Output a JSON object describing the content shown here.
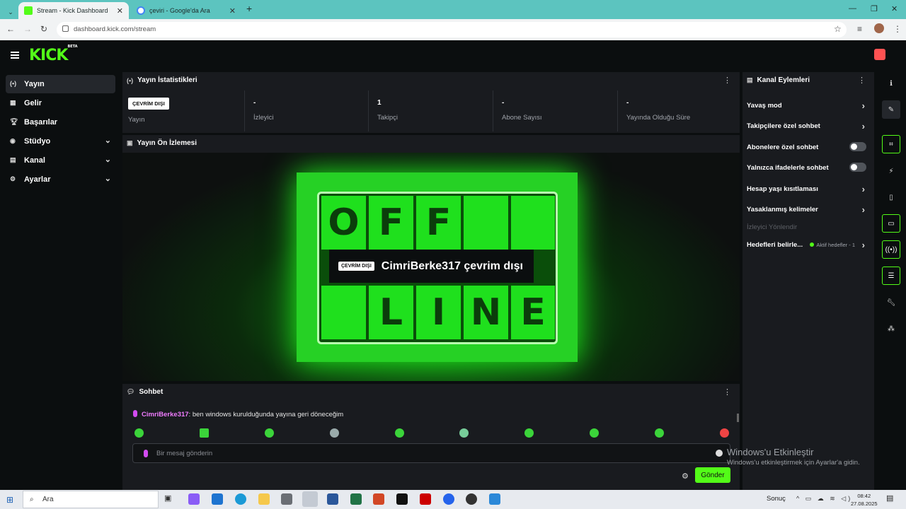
{
  "browser": {
    "tabs": [
      {
        "title": "Stream - Kick Dashboard",
        "favicon_color": "#53fc18"
      },
      {
        "title": "çeviri - Google'da Ara",
        "favicon_color": "#4285f4"
      }
    ],
    "url": "dashboard.kick.com/stream"
  },
  "header": {
    "logo": "KICK",
    "logo_badge": "BETA"
  },
  "sidebar": {
    "items": [
      {
        "label": "Yayın",
        "icon": "broadcast-icon",
        "active": true
      },
      {
        "label": "Gelir",
        "icon": "chart-icon"
      },
      {
        "label": "Başarılar",
        "icon": "trophy-icon"
      },
      {
        "label": "Stüdyo",
        "icon": "studio-icon",
        "expandable": true
      },
      {
        "label": "Kanal",
        "icon": "channel-icon",
        "expandable": true
      },
      {
        "label": "Ayarlar",
        "icon": "gear-icon",
        "expandable": true
      }
    ]
  },
  "stats": {
    "title": "Yayın İstatistikleri",
    "badge": "ÇEVRİM DIŞI",
    "cells": [
      {
        "value": "",
        "label": "Yayın"
      },
      {
        "value": "-",
        "label": "İzleyici"
      },
      {
        "value": "1",
        "label": "Takipçi"
      },
      {
        "value": "-",
        "label": "Abone Sayısı"
      },
      {
        "value": "-",
        "label": "Yayında Olduğu Süre"
      }
    ]
  },
  "preview": {
    "title": "Yayın Ön İzlemesi",
    "sign_letters": [
      "O",
      "F",
      "F",
      "",
      "",
      "",
      "L",
      "I",
      "N",
      "E"
    ],
    "overlay_badge": "ÇEVRİM DIŞI",
    "overlay_text": "CimriBerke317 çevrim dışı"
  },
  "chat": {
    "title": "Sohbet",
    "message_user": "CimriBerke317",
    "message_text": ": ben windows kurulduğunda yayına geri döneceğim",
    "placeholder": "Bir mesaj gönderin",
    "send_label": "Gönder",
    "emote_count": 10
  },
  "actions": {
    "title": "Kanal Eylemleri",
    "items": [
      {
        "label": "Yavaş mod",
        "control": "arrow"
      },
      {
        "label": "Takipçilere özel sohbet",
        "control": "arrow"
      },
      {
        "label": "Abonelere özel sohbet",
        "control": "toggle",
        "on": false
      },
      {
        "label": "Yalnızca ifadelerle sohbet",
        "control": "toggle",
        "on": false
      },
      {
        "label": "Hesap yaşı kısıtlaması",
        "control": "arrow"
      },
      {
        "label": "Yasaklanmış kelimeler",
        "control": "arrow"
      }
    ],
    "muted_label": "İzleyici Yönlendir",
    "goals_label": "Hedefleri belirle...",
    "goals_info": "Aktif hedefler - 1"
  },
  "watermark": {
    "line1": "Windows'u Etkinleştir",
    "line2": "Windows'u etkinleştirmek için Ayarlar'a gidin."
  },
  "taskbar": {
    "search_placeholder": "Ara",
    "weather": "Sonuç",
    "time": "08:42",
    "date": "27.08.2025"
  }
}
